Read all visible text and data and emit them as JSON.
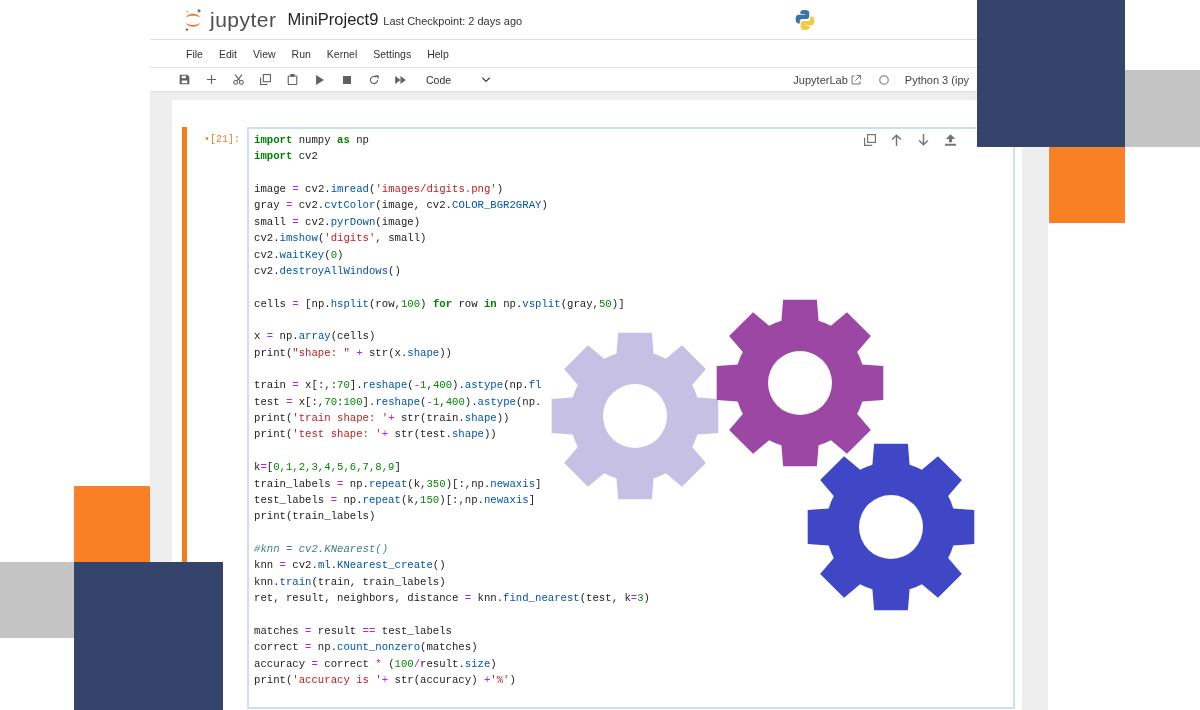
{
  "header": {
    "logo_text": "jupyter",
    "title": "MiniProject9",
    "checkpoint": "Last Checkpoint: 2 days ago"
  },
  "menu": [
    "File",
    "Edit",
    "View",
    "Run",
    "Kernel",
    "Settings",
    "Help"
  ],
  "toolbar": {
    "cell_type": "Code",
    "link": "JupyterLab",
    "kernel_busy": false,
    "kernel": "Python 3 (ipy"
  },
  "cell": {
    "selected": true,
    "prompt": "•[21]:",
    "blocks": [
      [
        [
          {
            "kind": "keyword",
            "text": "import"
          },
          {
            "kind": "plain",
            "text": " numpy "
          },
          {
            "kind": "keyword",
            "text": "as"
          },
          {
            "kind": "plain",
            "text": " np"
          }
        ],
        [
          {
            "kind": "keyword",
            "text": "import"
          },
          {
            "kind": "plain",
            "text": " cv2"
          }
        ]
      ],
      [
        [
          {
            "kind": "plain",
            "text": "image "
          },
          {
            "kind": "operator",
            "text": "="
          },
          {
            "kind": "plain",
            "text": " cv2."
          },
          {
            "kind": "property",
            "text": "imread"
          },
          {
            "kind": "plain",
            "text": "("
          },
          {
            "kind": "string",
            "text": "'images/digits.png'"
          },
          {
            "kind": "plain",
            "text": ")"
          }
        ],
        [
          {
            "kind": "plain",
            "text": "gray "
          },
          {
            "kind": "operator",
            "text": "="
          },
          {
            "kind": "plain",
            "text": " cv2."
          },
          {
            "kind": "property",
            "text": "cvtColor"
          },
          {
            "kind": "plain",
            "text": "(image, cv2."
          },
          {
            "kind": "property",
            "text": "COLOR_BGR2GRAY"
          },
          {
            "kind": "plain",
            "text": ")"
          }
        ],
        [
          {
            "kind": "plain",
            "text": "small "
          },
          {
            "kind": "operator",
            "text": "="
          },
          {
            "kind": "plain",
            "text": " cv2."
          },
          {
            "kind": "property",
            "text": "pyrDown"
          },
          {
            "kind": "plain",
            "text": "(image)"
          }
        ],
        [
          {
            "kind": "plain",
            "text": "cv2."
          },
          {
            "kind": "property",
            "text": "imshow"
          },
          {
            "kind": "plain",
            "text": "("
          },
          {
            "kind": "string",
            "text": "'digits'"
          },
          {
            "kind": "plain",
            "text": ", small)"
          }
        ],
        [
          {
            "kind": "plain",
            "text": "cv2."
          },
          {
            "kind": "property",
            "text": "waitKey"
          },
          {
            "kind": "plain",
            "text": "("
          },
          {
            "kind": "number",
            "text": "0"
          },
          {
            "kind": "plain",
            "text": ")"
          }
        ],
        [
          {
            "kind": "plain",
            "text": "cv2."
          },
          {
            "kind": "property",
            "text": "destroyAllWindows"
          },
          {
            "kind": "plain",
            "text": "()"
          }
        ]
      ],
      [
        [
          {
            "kind": "plain",
            "text": "cells "
          },
          {
            "kind": "operator",
            "text": "="
          },
          {
            "kind": "plain",
            "text": " [np."
          },
          {
            "kind": "property",
            "text": "hsplit"
          },
          {
            "kind": "plain",
            "text": "(row,"
          },
          {
            "kind": "number",
            "text": "100"
          },
          {
            "kind": "plain",
            "text": ") "
          },
          {
            "kind": "keyword",
            "text": "for"
          },
          {
            "kind": "plain",
            "text": " row "
          },
          {
            "kind": "keyword",
            "text": "in"
          },
          {
            "kind": "plain",
            "text": " np."
          },
          {
            "kind": "property",
            "text": "vsplit"
          },
          {
            "kind": "plain",
            "text": "(gray,"
          },
          {
            "kind": "number",
            "text": "50"
          },
          {
            "kind": "plain",
            "text": ")]"
          }
        ]
      ],
      [
        [
          {
            "kind": "plain",
            "text": "x "
          },
          {
            "kind": "operator",
            "text": "="
          },
          {
            "kind": "plain",
            "text": " np."
          },
          {
            "kind": "property",
            "text": "array"
          },
          {
            "kind": "plain",
            "text": "(cells)"
          }
        ],
        [
          {
            "kind": "plain",
            "text": "print("
          },
          {
            "kind": "string",
            "text": "\"shape: \""
          },
          {
            "kind": "operator",
            "text": " +"
          },
          {
            "kind": "plain",
            "text": " str(x."
          },
          {
            "kind": "property",
            "text": "shape"
          },
          {
            "kind": "plain",
            "text": "))"
          }
        ]
      ],
      [
        [
          {
            "kind": "plain",
            "text": "train "
          },
          {
            "kind": "operator",
            "text": "="
          },
          {
            "kind": "plain",
            "text": " x[:,:"
          },
          {
            "kind": "number",
            "text": "70"
          },
          {
            "kind": "plain",
            "text": "]."
          },
          {
            "kind": "property",
            "text": "reshape"
          },
          {
            "kind": "plain",
            "text": "("
          },
          {
            "kind": "operator",
            "text": "-"
          },
          {
            "kind": "number",
            "text": "1"
          },
          {
            "kind": "plain",
            "text": ","
          },
          {
            "kind": "number",
            "text": "400"
          },
          {
            "kind": "plain",
            "text": ")."
          },
          {
            "kind": "property",
            "text": "astype"
          },
          {
            "kind": "plain",
            "text": "(np."
          },
          {
            "kind": "property",
            "text": "fl"
          }
        ],
        [
          {
            "kind": "plain",
            "text": "test "
          },
          {
            "kind": "operator",
            "text": "="
          },
          {
            "kind": "plain",
            "text": " x[:,"
          },
          {
            "kind": "number",
            "text": "70"
          },
          {
            "kind": "plain",
            "text": ":"
          },
          {
            "kind": "number",
            "text": "100"
          },
          {
            "kind": "plain",
            "text": "]."
          },
          {
            "kind": "property",
            "text": "reshape"
          },
          {
            "kind": "plain",
            "text": "("
          },
          {
            "kind": "operator",
            "text": "-"
          },
          {
            "kind": "number",
            "text": "1"
          },
          {
            "kind": "plain",
            "text": ","
          },
          {
            "kind": "number",
            "text": "400"
          },
          {
            "kind": "plain",
            "text": ")."
          },
          {
            "kind": "property",
            "text": "astype"
          },
          {
            "kind": "plain",
            "text": "(np."
          }
        ],
        [
          {
            "kind": "plain",
            "text": "print("
          },
          {
            "kind": "string",
            "text": "'train shape: '"
          },
          {
            "kind": "operator",
            "text": "+"
          },
          {
            "kind": "plain",
            "text": " str(train."
          },
          {
            "kind": "property",
            "text": "shape"
          },
          {
            "kind": "plain",
            "text": "))"
          }
        ],
        [
          {
            "kind": "plain",
            "text": "print("
          },
          {
            "kind": "string",
            "text": "'test shape: '"
          },
          {
            "kind": "operator",
            "text": "+"
          },
          {
            "kind": "plain",
            "text": " str(test."
          },
          {
            "kind": "property",
            "text": "shape"
          },
          {
            "kind": "plain",
            "text": "))"
          }
        ]
      ],
      [
        [
          {
            "kind": "plain",
            "text": "k"
          },
          {
            "kind": "operator",
            "text": "="
          },
          {
            "kind": "plain",
            "text": "["
          },
          {
            "kind": "number",
            "text": "0,1,2,3,4,5,6,7,8,9"
          },
          {
            "kind": "plain",
            "text": "]"
          }
        ],
        [
          {
            "kind": "plain",
            "text": "train_labels "
          },
          {
            "kind": "operator",
            "text": "="
          },
          {
            "kind": "plain",
            "text": " np."
          },
          {
            "kind": "property",
            "text": "repeat"
          },
          {
            "kind": "plain",
            "text": "(k,"
          },
          {
            "kind": "number",
            "text": "350"
          },
          {
            "kind": "plain",
            "text": ")[:,np."
          },
          {
            "kind": "property",
            "text": "newaxis"
          },
          {
            "kind": "plain",
            "text": "]"
          }
        ],
        [
          {
            "kind": "plain",
            "text": "test_labels "
          },
          {
            "kind": "operator",
            "text": "="
          },
          {
            "kind": "plain",
            "text": " np."
          },
          {
            "kind": "property",
            "text": "repeat"
          },
          {
            "kind": "plain",
            "text": "(k,"
          },
          {
            "kind": "number",
            "text": "150"
          },
          {
            "kind": "plain",
            "text": ")[:,np."
          },
          {
            "kind": "property",
            "text": "newaxis"
          },
          {
            "kind": "plain",
            "text": "]"
          }
        ],
        [
          {
            "kind": "plain",
            "text": "print(train_labels)"
          }
        ]
      ],
      [
        [
          {
            "kind": "comment",
            "text": "#knn = cv2.KNearest()"
          }
        ],
        [
          {
            "kind": "plain",
            "text": "knn "
          },
          {
            "kind": "operator",
            "text": "="
          },
          {
            "kind": "plain",
            "text": " cv2."
          },
          {
            "kind": "property",
            "text": "ml"
          },
          {
            "kind": "plain",
            "text": "."
          },
          {
            "kind": "property",
            "text": "KNearest_create"
          },
          {
            "kind": "plain",
            "text": "()"
          }
        ],
        [
          {
            "kind": "plain",
            "text": "knn."
          },
          {
            "kind": "property",
            "text": "train"
          },
          {
            "kind": "plain",
            "text": "(train, train_labels)"
          }
        ],
        [
          {
            "kind": "plain",
            "text": "ret, result, neighbors, distance "
          },
          {
            "kind": "operator",
            "text": "="
          },
          {
            "kind": "plain",
            "text": " knn."
          },
          {
            "kind": "property",
            "text": "find_nearest"
          },
          {
            "kind": "plain",
            "text": "(test, k"
          },
          {
            "kind": "operator",
            "text": "="
          },
          {
            "kind": "number",
            "text": "3"
          },
          {
            "kind": "plain",
            "text": ")"
          }
        ]
      ],
      [
        [
          {
            "kind": "plain",
            "text": "matches "
          },
          {
            "kind": "operator",
            "text": "="
          },
          {
            "kind": "plain",
            "text": " result "
          },
          {
            "kind": "operator",
            "text": "=="
          },
          {
            "kind": "plain",
            "text": " test_labels"
          }
        ],
        [
          {
            "kind": "plain",
            "text": "correct "
          },
          {
            "kind": "operator",
            "text": "="
          },
          {
            "kind": "plain",
            "text": " np."
          },
          {
            "kind": "property",
            "text": "count_nonzero"
          },
          {
            "kind": "plain",
            "text": "(matches)"
          }
        ],
        [
          {
            "kind": "plain",
            "text": "accuracy "
          },
          {
            "kind": "operator",
            "text": "="
          },
          {
            "kind": "plain",
            "text": " correct "
          },
          {
            "kind": "operator",
            "text": "*"
          },
          {
            "kind": "plain",
            "text": " ("
          },
          {
            "kind": "number",
            "text": "100"
          },
          {
            "kind": "operator",
            "text": "/"
          },
          {
            "kind": "plain",
            "text": "result."
          },
          {
            "kind": "property",
            "text": "size"
          },
          {
            "kind": "plain",
            "text": ")"
          }
        ],
        [
          {
            "kind": "plain",
            "text": "print("
          },
          {
            "kind": "string",
            "text": "'accuracy is '"
          },
          {
            "kind": "operator",
            "text": "+"
          },
          {
            "kind": "plain",
            "text": " str(accuracy) "
          },
          {
            "kind": "operator",
            "text": "+"
          },
          {
            "kind": "string",
            "text": "'%'"
          },
          {
            "kind": "plain",
            "text": ")"
          }
        ]
      ]
    ]
  },
  "decoration": {
    "gears": [
      {
        "color": "#c6c0e4"
      },
      {
        "color": "#9c47a3"
      },
      {
        "color": "#3f47c7"
      }
    ]
  }
}
